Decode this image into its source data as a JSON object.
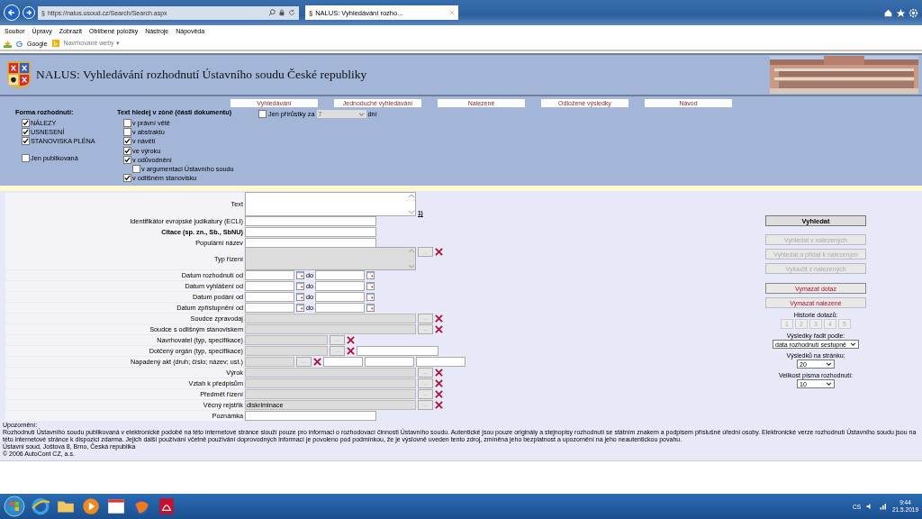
{
  "browser": {
    "address_icon": "§",
    "address": "https://nalus.usoud.cz/Search/Search.aspx",
    "tab_icon": "§",
    "tab_title": "NALUS: Vyhledávání rozho...",
    "menu": [
      "Soubor",
      "Úpravy",
      "Zobrazit",
      "Oblíbené položky",
      "Nástroje",
      "Nápověda"
    ],
    "favorites": [
      "Google",
      "Navrhované weby ▾"
    ]
  },
  "header": {
    "title": "NALUS: Vyhledávání rozhodnutí Ústavního soudu České republiky"
  },
  "tabs": [
    {
      "label": "Vyhledávání",
      "selected": false
    },
    {
      "label": "Jednoduché vyhledávání",
      "selected": false
    },
    {
      "label": "Nalezené",
      "selected": false
    },
    {
      "label": "Odložené výsledky",
      "selected": false
    },
    {
      "label": "Návod",
      "selected": false
    }
  ],
  "form_type": {
    "heading": "Forma rozhodnutí:",
    "options": [
      {
        "label": "NÁLEZY",
        "checked": true
      },
      {
        "label": "USNESENÍ",
        "checked": true
      },
      {
        "label": "STANOVISKA PLÉNA",
        "checked": true
      }
    ],
    "published": {
      "label": "Jen publikovaná",
      "checked": false
    }
  },
  "zones": {
    "heading": "Text hledej v zóně (části dokumentu)",
    "options": [
      {
        "label": "v právní větě",
        "checked": false
      },
      {
        "label": "v abstraktu",
        "checked": false
      },
      {
        "label": "v návětí",
        "checked": true
      },
      {
        "label": "ve výroku",
        "checked": true
      },
      {
        "label": "v odůvodnění",
        "checked": true,
        "children": [
          {
            "label": "v argumentaci Ústavního soudu",
            "checked": false
          }
        ]
      },
      {
        "label": "v odlišném stanovisku",
        "checked": true
      }
    ]
  },
  "increments": {
    "label": "Jen přírůstky za",
    "checked": false,
    "value": "7",
    "unit": "dní"
  },
  "fields": [
    {
      "label": "Text",
      "kind": "textarea",
      "note": "1)"
    },
    {
      "label": "Identifikátor evropské judikatury (ECLI)",
      "kind": "text"
    },
    {
      "label": "Citace (sp. zn., Sb., SbNU)",
      "kind": "text",
      "bold": true
    },
    {
      "label": "Populární název",
      "kind": "text"
    },
    {
      "label": "Typ řízení",
      "kind": "list",
      "button": "..."
    },
    {
      "label": "Datum rozhodnutí od",
      "kind": "date",
      "to": "do"
    },
    {
      "label": "Datum vyhlášení od",
      "kind": "date",
      "to": "do"
    },
    {
      "label": "Datum podání od",
      "kind": "date",
      "to": "do"
    },
    {
      "label": "Datum zpřístupnění od",
      "kind": "date",
      "to": "do"
    },
    {
      "label": "Soudce zpravodaj",
      "kind": "lookup",
      "button": "..."
    },
    {
      "label": "Soudce s odlišným stanoviskem",
      "kind": "lookup",
      "button": "..."
    },
    {
      "label": "Navrhovatel (typ, specifikace)",
      "kind": "lookup_short",
      "button": "..."
    },
    {
      "label": "Dotčený orgán (typ, specifikace)",
      "kind": "lookup_spec",
      "button": "..."
    },
    {
      "label": "Napadený akt (druh; číslo; název; ust.)",
      "kind": "act",
      "button": "..."
    },
    {
      "label": "Výrok",
      "kind": "lookup",
      "button": "..."
    },
    {
      "label": "Vztah k předpisům",
      "kind": "lookup",
      "button": "..."
    },
    {
      "label": "Předmět řízení",
      "kind": "lookup",
      "button": "..."
    },
    {
      "label": "Věcný rejstřík",
      "kind": "lookup",
      "button": "...",
      "value": "diskriminace"
    },
    {
      "label": "Poznámka",
      "kind": "text"
    }
  ],
  "actions": [
    {
      "label": "Vyhledat",
      "kind": "primary",
      "disabled": false
    },
    {
      "label": "Vyhledat v nalezených",
      "kind": "secondary",
      "disabled": true
    },
    {
      "label": "Vyhledat a přidat k nalezeným",
      "kind": "secondary",
      "disabled": true
    },
    {
      "label": "Vyloučit z nalezených",
      "kind": "secondary",
      "disabled": true
    },
    {
      "label": "Vymazat dotaz",
      "kind": "danger",
      "disabled": false
    },
    {
      "label": "Vymazat nalezené",
      "kind": "danger",
      "disabled": false
    }
  ],
  "history": {
    "label": "Historie dotazů:",
    "items": [
      {
        "label": "1",
        "disabled": true
      },
      {
        "label": "2",
        "disabled": true
      },
      {
        "label": "3",
        "disabled": true
      },
      {
        "label": "4",
        "disabled": true
      },
      {
        "label": "5",
        "disabled": true
      }
    ]
  },
  "settings": [
    {
      "label": "Výsledky řadit podle:",
      "value": "data rozhodnutí sestupně"
    },
    {
      "label": "Výsledků na stránku:",
      "value": "20"
    },
    {
      "label": "Velikost písma rozhodnutí:",
      "value": "10"
    }
  ],
  "footer": {
    "heading": "Upozornění:",
    "notice": "Rozhodnutí Ústavního soudu publikovaná v elektronické podobě na této internetové stránce slouží pouze pro informaci o rozhodovací činnosti Ústavního soudu. Autentické jsou pouze originály a stejnopisy rozhodnutí se státním znakem a podpisem příslušné úřední osoby. Elektronické verze rozhodnutí Ústavního soudu jsou na této internetové stránce k dispozici zdarma. Jejich další používání včetně používání doprovodných informací je povoleno pod podmínkou, že je výslovně uveden tento zdroj, zmíněna jeho bezplatnost a upozornění na jeho neautentickou povahu.",
    "address": "Ústavní soud, Joštova 8, Brno, Česká republika",
    "copyright": "© 2006 AutoCont CZ, a.s."
  },
  "taskbar": {
    "language": "CS",
    "time": "9:44",
    "date": "21.5.2019"
  }
}
